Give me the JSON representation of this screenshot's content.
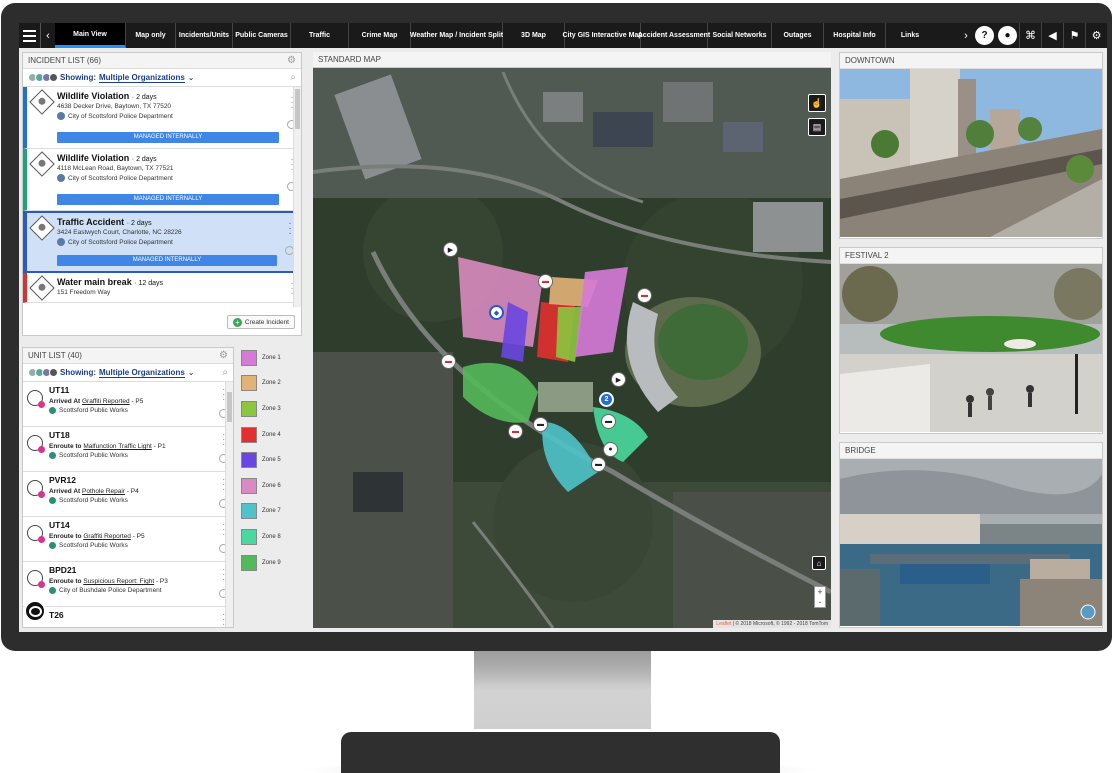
{
  "nav": {
    "tabs": [
      "Main View",
      "Map only",
      "Incidents/Units",
      "Public Cameras",
      "Traffic",
      "Crime Map",
      "Weather Map / Incident Split",
      "3D Map",
      "City GIS Interactive Map",
      "Accident Assessment",
      "Social Networks",
      "Outages",
      "Hospital Info",
      "Links"
    ],
    "active_tab": "Main View",
    "icons": [
      "help-icon",
      "chat-icon",
      "network-icon",
      "announce-icon",
      "flag-icon",
      "settings-icon"
    ]
  },
  "incident_list": {
    "title": "INCIDENT LIST",
    "count": "(66)",
    "filter_prefix": "Showing:",
    "filter_value": "Multiple Organizations",
    "items": [
      {
        "title": "Wildlife Violation",
        "age": "2 days",
        "address": "4638 Decker Drive, Baytown, TX 77520",
        "org": "City of Scottsford Police Department",
        "badge": "MANAGED INTERNALLY",
        "color": "#1e6fd9"
      },
      {
        "title": "Wildlife Violation",
        "age": "2 days",
        "address": "4118 McLean Road, Baytown, TX 77521",
        "org": "City of Scottsford Police Department",
        "badge": "MANAGED INTERNALLY",
        "color": "#1fa37a"
      },
      {
        "title": "Traffic Accident",
        "age": "2 days",
        "address": "3424 Eastwych Court, Charlotte, NC 28226",
        "org": "City of Scottsford Police Department",
        "badge": "MANAGED INTERNALLY",
        "color": "#2a58c4"
      },
      {
        "title": "Water main break",
        "age": "12 days",
        "address": "151 Freedom Way",
        "org": "",
        "badge": "",
        "color": "#d93030"
      }
    ],
    "create_label": "Create Incident"
  },
  "unit_list": {
    "title": "UNIT LIST",
    "count": "(40)",
    "filter_prefix": "Showing:",
    "filter_value": "Multiple Organizations",
    "items": [
      {
        "name": "UT11",
        "state": "Arrived At",
        "target": "Graffiti Reported",
        "priority": "- P5",
        "org": "Scottsford Public Works"
      },
      {
        "name": "UT18",
        "state": "Enroute to",
        "target": "Malfunction Traffic Light",
        "priority": "- P1",
        "org": "Scottsford Public Works"
      },
      {
        "name": "PVR12",
        "state": "Arrived At",
        "target": "Pothole Repair",
        "priority": "- P4",
        "org": "Scottsford Public Works"
      },
      {
        "name": "UT14",
        "state": "Enroute to",
        "target": "Graffiti Reported",
        "priority": "- P5",
        "org": "Scottsford Public Works"
      },
      {
        "name": "BPD21",
        "state": "Enroute to",
        "target": "Suspicious Report: Fight",
        "priority": "- P3",
        "org": "City of Bushdale Police Department"
      },
      {
        "name": "T26",
        "state": "",
        "target": "",
        "priority": "",
        "org": ""
      }
    ]
  },
  "zones": [
    {
      "label": "Zone 1",
      "color": "#d67ad8"
    },
    {
      "label": "Zone 2",
      "color": "#e2b277"
    },
    {
      "label": "Zone 3",
      "color": "#8cc63f"
    },
    {
      "label": "Zone 4",
      "color": "#e3302f"
    },
    {
      "label": "Zone 5",
      "color": "#6a46e0"
    },
    {
      "label": "Zone 6",
      "color": "#d98ac0"
    },
    {
      "label": "Zone 7",
      "color": "#4fc3c9"
    },
    {
      "label": "Zone 8",
      "color": "#4ad8a0"
    },
    {
      "label": "Zone 9",
      "color": "#54b95a"
    }
  ],
  "map": {
    "title": "STANDARD MAP",
    "cluster_count": "2",
    "attribution_link": "Leaflet",
    "attribution_text": "| © 2018 Microsoft, © 1992 - 2018 TomTom",
    "zoom_in": "+",
    "zoom_out": "-"
  },
  "cameras": [
    {
      "title": "DOWNTOWN"
    },
    {
      "title": "FESTIVAL 2"
    },
    {
      "title": "BRIDGE"
    }
  ]
}
